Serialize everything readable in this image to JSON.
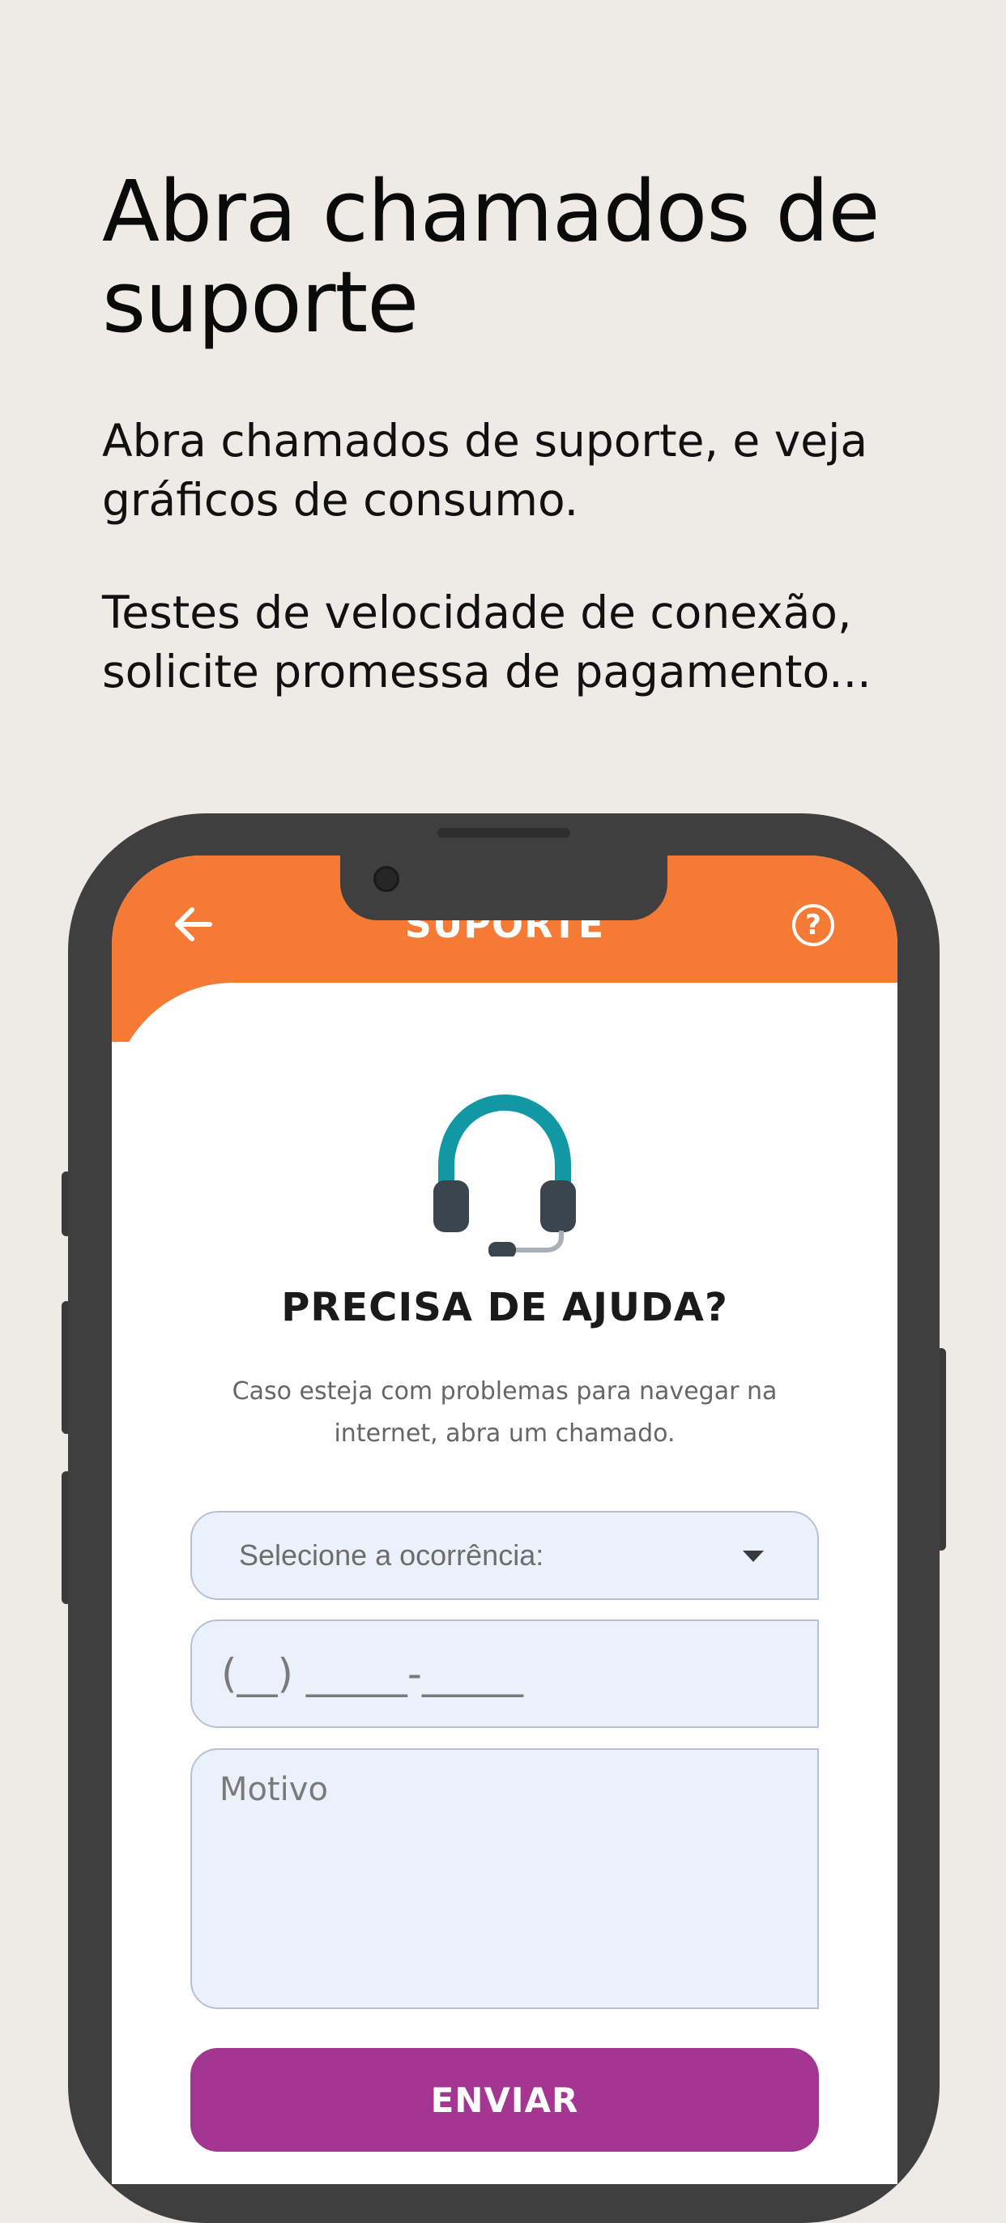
{
  "promo": {
    "title": "Abra chamados de suporte",
    "paragraph1": "Abra chamados de suporte, e veja gráficos de consumo.",
    "paragraph2": "Testes de velocidade de conexão, solicite promessa de pagamento..."
  },
  "app": {
    "header": {
      "title": "SUPORTE",
      "back_icon": "arrow-left-icon",
      "help_icon": "question-circle-icon",
      "help_glyph": "?",
      "background_color": "#F47A35"
    },
    "illustration_icon": "headset-icon",
    "heading": "PRECISA DE AJUDA?",
    "description": "Caso esteja com problemas para navegar na internet, abra um chamado.",
    "form": {
      "occurrence_select": {
        "value": "Selecione a ocorrência:",
        "icon": "caret-down-icon"
      },
      "phone_placeholder": "(__) _____-_____",
      "reason_placeholder": "Motivo",
      "submit_label": "ENVIAR",
      "submit_color": "#A43591"
    }
  }
}
